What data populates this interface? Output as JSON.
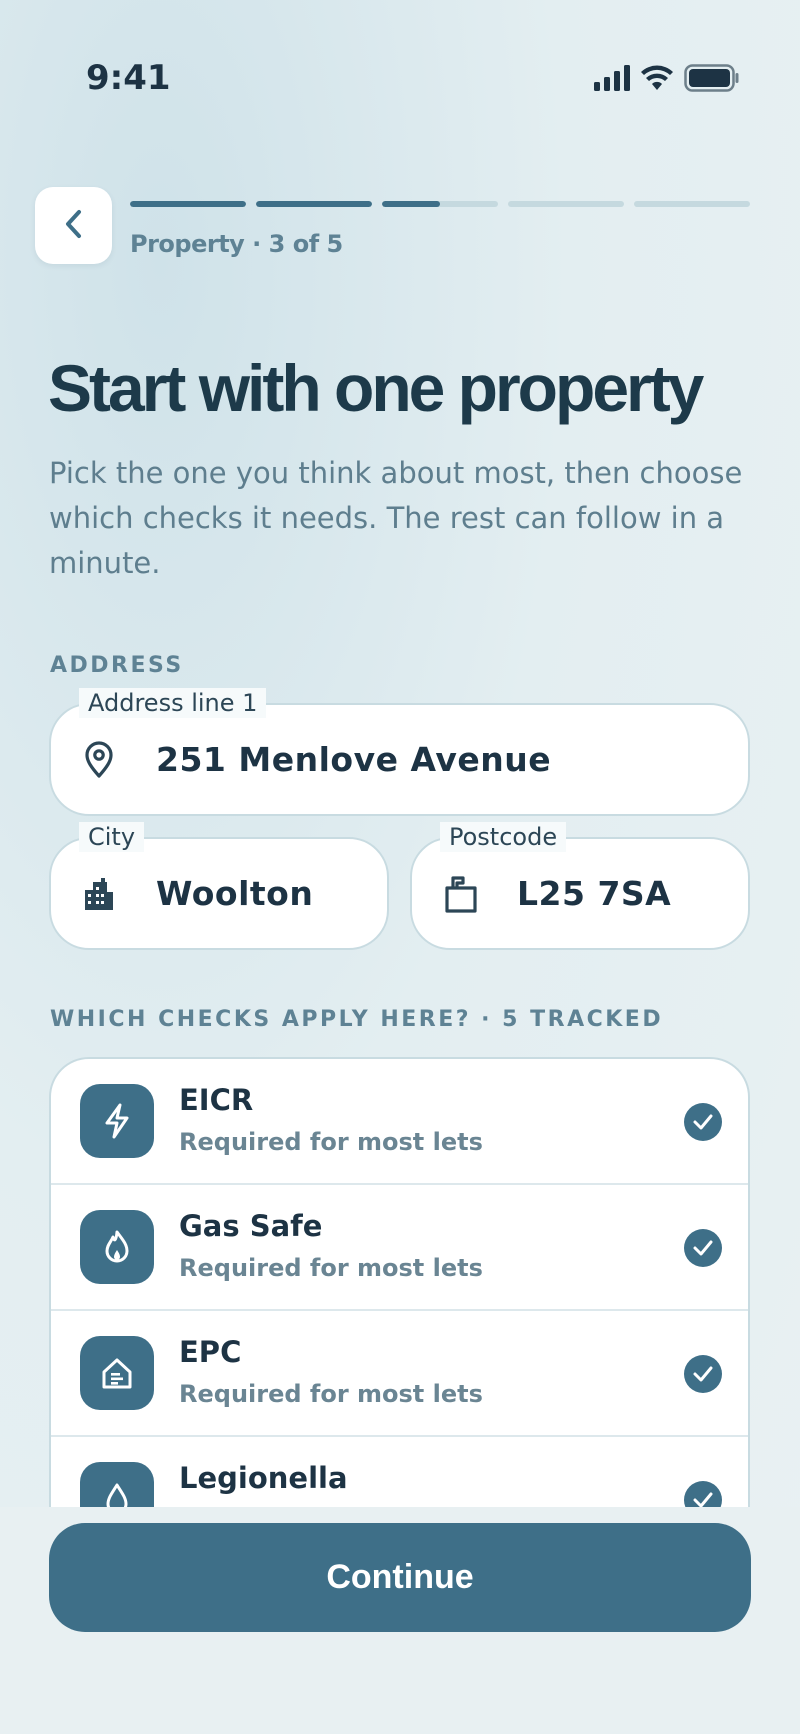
{
  "status_bar": {
    "time": "9:41"
  },
  "header": {
    "step_label": "Property · 3 of 5",
    "progress": {
      "steps": 5,
      "current": 3,
      "segment_fill": [
        1,
        1,
        0.5,
        0,
        0
      ]
    }
  },
  "title": "Start with one property",
  "subtitle": "Pick the one you think about most, then choose which checks it needs. The rest can follow in a minute.",
  "address": {
    "section_label": "ADDRESS",
    "line1": {
      "label": "Address line 1",
      "value": "251 Menlove Avenue",
      "icon": "location-pin-icon"
    },
    "city": {
      "label": "City",
      "value": "Woolton",
      "icon": "city-buildings-icon"
    },
    "postcode": {
      "label": "Postcode",
      "value": "L25 7SA",
      "icon": "mailbox-icon"
    }
  },
  "checks": {
    "section_label": "WHICH CHECKS APPLY HERE? · 5 TRACKED",
    "items": [
      {
        "name": "EICR",
        "subtitle": "Required for most lets",
        "icon": "lightning-icon",
        "checked": true
      },
      {
        "name": "Gas Safe",
        "subtitle": "Required for most lets",
        "icon": "flame-icon",
        "checked": true
      },
      {
        "name": "EPC",
        "subtitle": "Required for most lets",
        "icon": "house-energy-icon",
        "checked": true
      },
      {
        "name": "Legionella",
        "subtitle": "",
        "icon": "water-drop-icon",
        "checked": true
      }
    ]
  },
  "footer": {
    "continue_label": "Continue"
  },
  "colors": {
    "accent": "#3e6f88",
    "text_dark": "#1d3a4a",
    "text_muted": "#5e8294",
    "border": "#c8dbe1"
  }
}
